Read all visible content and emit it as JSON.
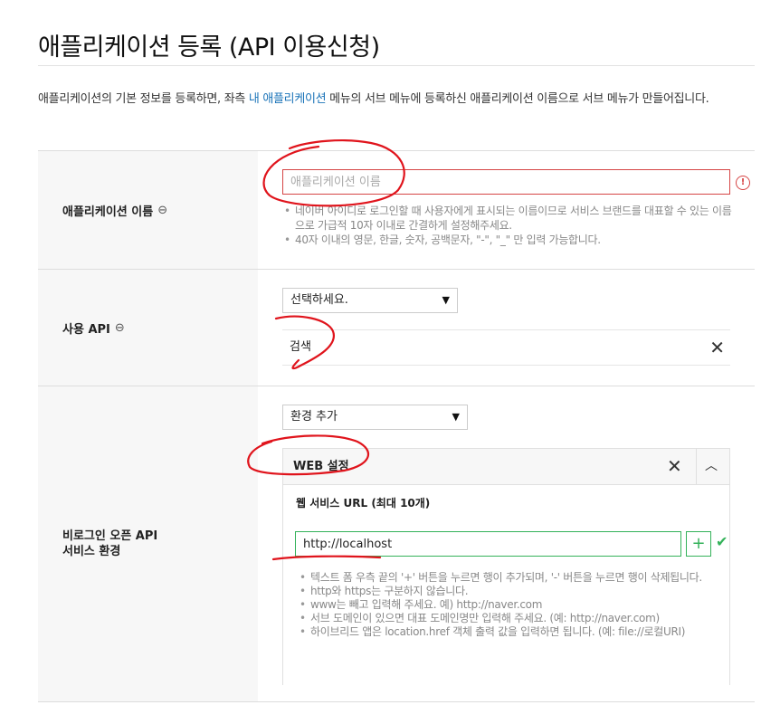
{
  "page": {
    "title": "애플리케이션 등록 (API 이용신청)",
    "intro_before": "애플리케이션의 기본 정보를 등록하면, 좌측 ",
    "intro_link": "내 애플리케이션",
    "intro_after": " 메뉴의 서브 메뉴에 등록하신 애플리케이션 이름으로 서브 메뉴가 만들어집니다."
  },
  "app_name": {
    "label": "애플리케이션 이름",
    "placeholder": "애플리케이션 이름",
    "error_icon": "!",
    "hints": [
      "네이버 아이디로 로그인할 때 사용자에게 표시되는 이름이므로 서비스 브랜드를 대표할 수 있는 이름으로 가급적 10자 이내로 간결하게 설정해주세요.",
      "40자 이내의 영문, 한글, 숫자, 공백문자, \"-\", \"_\" 만 입력 가능합니다."
    ]
  },
  "api": {
    "label": "사용 API",
    "select_value": "선택하세요.",
    "selected_items": [
      "검색"
    ]
  },
  "env": {
    "label_line1": "비로그인 오픈 API",
    "label_line2": "서비스 환경",
    "select_value": "환경 추가",
    "web": {
      "title": "WEB 설정",
      "url_label": "웹 서비스 URL (최대 10개)",
      "url_value": "http://localhost",
      "add_label": "+",
      "hints": [
        "텍스트 폼 우측 끝의 '+' 버튼을 누르면 행이 추가되며, '-' 버튼을 누르면 행이 삭제됩니다.",
        "http와 https는 구분하지 않습니다.",
        "www는 빼고 입력해 주세요. 예) http://naver.com",
        "서브 도메인이 있으면 대표 도메인명만 입력해 주세요. (예: http://naver.com)",
        "하이브리드 앱은 location.href 객체 출력 값을 입력하면 됩니다. (예: file://로컬URI)"
      ]
    }
  },
  "icons": {
    "link": "⊖",
    "caret": "▼",
    "close": "✕",
    "collapse": "︿",
    "check": "✔"
  },
  "colors": {
    "error": "#d64545",
    "valid": "#34b25a",
    "link": "#1a73b8",
    "annotation": "#e0141c"
  }
}
